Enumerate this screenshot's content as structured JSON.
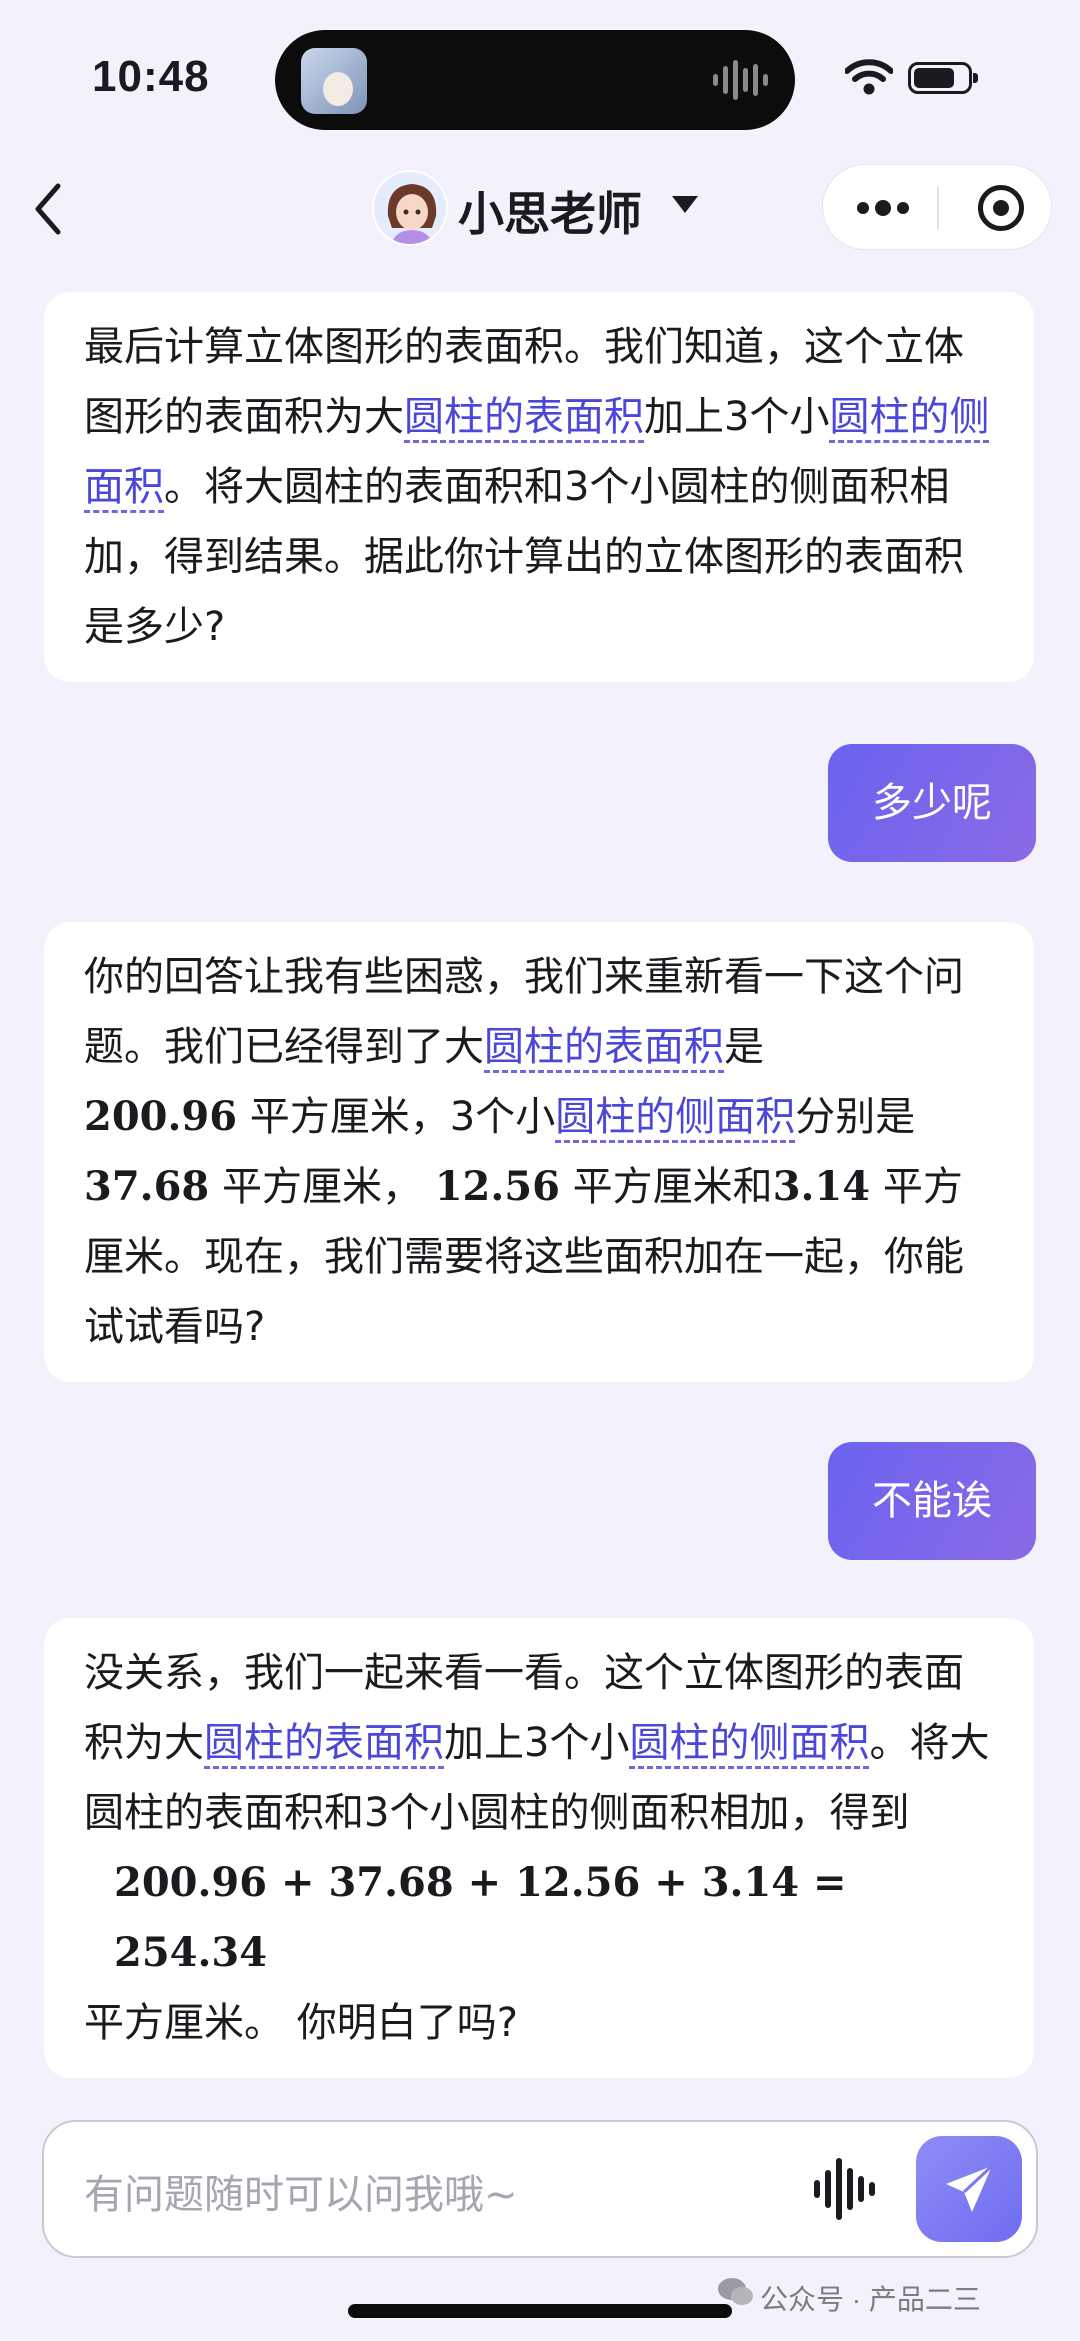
{
  "status_bar": {
    "time": "10:48"
  },
  "nav": {
    "title": "小思老师"
  },
  "messages": {
    "m1": {
      "p1": "最后计算立体图形的表面积。我们知道，这个立体图形的表面积为大",
      "k1": "圆柱的表面积",
      "p2": "加上3个小",
      "k2": "圆柱的侧面积",
      "p3": "。将大圆柱的表面积和3个小圆柱的侧面积相加，得到结果。据此你计算出的立体图形的表面积是多少?"
    },
    "u1": "多少呢",
    "m2": {
      "p1": "你的回答让我有些困惑，我们来重新看一下这个问题。我们已经得到了大",
      "k1": "圆柱的表面积",
      "p2": "是",
      "n1": "200.96",
      "p3": " 平方厘米，3个小",
      "k2": "圆柱的侧面积",
      "p4": "分别是",
      "n2": "37.68",
      "p5": " 平方厘米，",
      "n3": "12.56",
      "p6": " 平方厘米和",
      "n4": "3.14",
      "p7": " 平方厘米。现在，我们需要将这些面积加在一起，你能试试看吗?"
    },
    "u2": "不能诶",
    "m3": {
      "p1": "没关系，我们一起来看一看。这个立体图形的表面积为大",
      "k1": "圆柱的表面积",
      "p2": "加上3个小",
      "k2": "圆柱的侧面积",
      "p3": "。将大圆柱的表面积和3个小圆柱的侧面积相加，得到",
      "equation": "200.96 + 37.68 + 12.56 + 3.14 = 254.34",
      "p4": "平方厘米。 你明白了吗?"
    }
  },
  "input": {
    "placeholder": "有问题随时可以问我哦~"
  },
  "watermark": "公众号 · 产品二三",
  "icons": {
    "back": "chevron-left-icon",
    "more": "more-dots-icon",
    "record": "record-icon",
    "voice": "voice-wave-icon",
    "send": "send-plane-icon"
  },
  "colors": {
    "accent": "#6a63f0",
    "keyword": "#4b48d9",
    "background": "#f3f2fc"
  }
}
